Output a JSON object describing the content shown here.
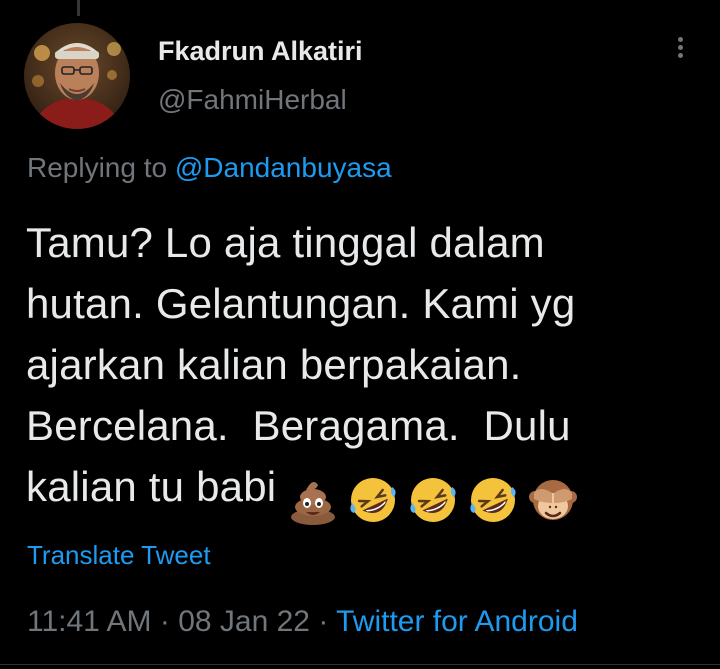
{
  "tweet": {
    "author": {
      "display_name": "Fkadrun Alkatiri",
      "handle": "@FahmiHerbal",
      "avatar_icon": "profile-photo"
    },
    "reply": {
      "prefix": "Replying to ",
      "mention": "@Dandanbuyasa"
    },
    "text_lines": [
      "Tamu? Lo aja tinggal dalam",
      "hutan. Gelantungan. Kami yg",
      "ajarkan kalian berpakaian.",
      "Bercelana.  Beragama.  Dulu",
      "kalian tu babi"
    ],
    "emojis": [
      "pile-of-poo-icon",
      "rolling-laughing-icon",
      "rolling-laughing-icon",
      "rolling-laughing-icon",
      "see-no-evil-monkey-icon"
    ],
    "translate_label": "Translate Tweet",
    "time": "11:41 AM",
    "separator": " · ",
    "date": "08 Jan 22",
    "source": "Twitter for Android",
    "more_icon": "more-vertical-icon"
  },
  "colors": {
    "background": "#000000",
    "text": "#e7e9ea",
    "secondary": "#71767b",
    "accent": "#1d9bf0"
  }
}
